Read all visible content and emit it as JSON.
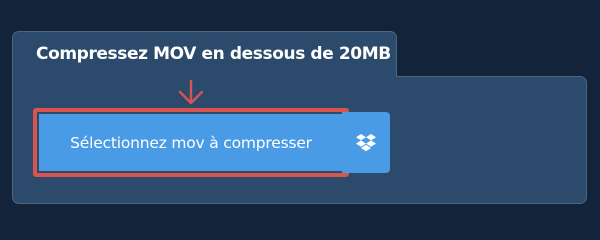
{
  "card": {
    "title": "Compressez MOV en dessous de 20MB"
  },
  "upload": {
    "select_label": "Sélectionnez mov à compresser",
    "dropbox_icon": "dropbox-icon"
  },
  "colors": {
    "background": "#13243a",
    "card": "#2c4a6c",
    "button": "#4a9be6",
    "highlight": "#d9534f"
  }
}
